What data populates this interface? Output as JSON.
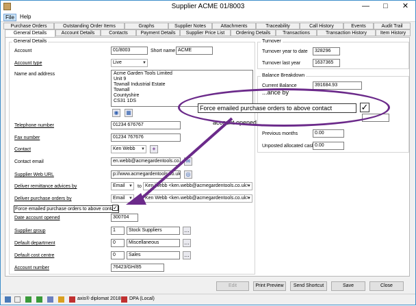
{
  "window": {
    "title": "Supplier ACME 01/8003"
  },
  "menu": {
    "file": "File",
    "help": "Help"
  },
  "tabs_top": [
    "Purchase Orders",
    "Outstanding Order Items",
    "Graphs",
    "Supplier Notes",
    "Attachments",
    "Traceability",
    "Call History",
    "Events",
    "Audit Trail"
  ],
  "tabs_bottom": [
    "General Details",
    "Account Details",
    "Contacts",
    "Payment Details",
    "Supplier Price List",
    "Ordering Details",
    "Transactions",
    "Transaction History",
    "Item History"
  ],
  "general": {
    "legend": "General Details",
    "account_label": "Account",
    "account_value": "01/8003",
    "short_name_label": "Short name",
    "short_name_value": "ACME",
    "account_type_label": "Account type",
    "account_type_value": "Live",
    "name_address_label": "Name and address",
    "name_address_value": "Acme Garden Tools Limited\nUnit 9\nTownall Industrial Estate\nTownall\nCountyshire\nCS31 1DS",
    "telephone_label": "Telephone number",
    "telephone_value": "01234 676767",
    "fax_label": "Fax number",
    "fax_value": "01234 767676",
    "contact_label": "Contact",
    "contact_value": "Ken Webb",
    "contact_email_label": "Contact email",
    "contact_email_value": "en.webb@acmegardentools.co.uk",
    "web_url_label": "Supplier Web URL",
    "web_url_value": "p://www.acmegardentools.co.uk/",
    "remittance_label": "Deliver remittance advices by",
    "remittance_method": "Email",
    "remittance_to": "to",
    "remittance_contact": "Ken Webb <ken.webb@acmegardentools.co.uk>",
    "po_label": "Deliver purchase orders by",
    "po_method": "Email",
    "po_to": "to",
    "po_contact": "Ken Webb <ken.webb@acmegardentools.co.uk>",
    "force_label": "Force emailed purchase orders to above contact",
    "date_opened_label": "Date account opened",
    "date_opened_value": "300704",
    "supplier_group_label": "Supplier group",
    "supplier_group_code": "1",
    "supplier_group_name": "Stock Suppliers",
    "default_dept_label": "Default department",
    "default_dept_code": "0",
    "default_dept_name": "Miscellaneous",
    "default_cost_label": "Default cost centre",
    "default_cost_code": "0",
    "default_cost_name": "Sales",
    "account_number_label": "Account number",
    "account_number_value": "76423/GH/85"
  },
  "turnover": {
    "legend": "Turnover",
    "ytd_label": "Turnover year to date",
    "ytd_value": "328296",
    "last_year_label": "Turnover last year",
    "last_year_value": "1637365"
  },
  "balance": {
    "legend": "Balance Breakdown",
    "current_label": "Current Balance",
    "current_value": "391684.93",
    "partial_label": "...ance by",
    "opened_partial": "account opened",
    "previous_label": "Previous months",
    "previous_value": "0.00",
    "unposted_label": "Unposted allocated cash",
    "unposted_value": "0.00"
  },
  "callout": {
    "text": "Force emailed purchase orders to above contact"
  },
  "buttons": {
    "edit": "Edit",
    "print_preview": "Print Preview",
    "send_shortcut": "Send Shortcut",
    "save": "Save",
    "close": "Close"
  },
  "status": {
    "product": "axis® diplomat 2018",
    "dpa": "DPA (Local)"
  },
  "colors": {
    "accent": "#6b2a8a",
    "window_border": "#3c8dc9"
  }
}
